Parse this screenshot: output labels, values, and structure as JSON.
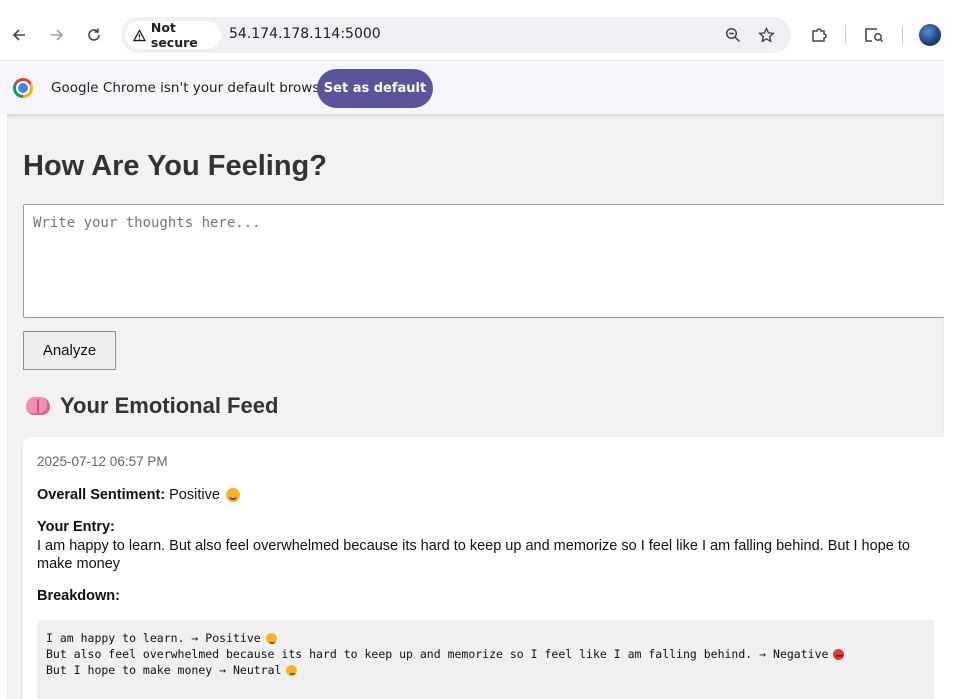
{
  "browser": {
    "security_chip": "Not secure",
    "url": "54.174.178.114:5000",
    "infobar_message": "Google Chrome isn't your default browser",
    "set_default_label": "Set as default",
    "accent_color": "#5a559b"
  },
  "page": {
    "title": "How Are You Feeling?",
    "textarea_placeholder": "Write your thoughts here...",
    "textarea_value": "",
    "analyze_label": "Analyze",
    "feed_heading": "Your Emotional Feed",
    "feed_icon": "brain-icon"
  },
  "feed": [
    {
      "timestamp": "2025-07-12 06:57 PM",
      "overall_label": "Overall Sentiment:",
      "overall_value": "Positive",
      "overall_icon": "smiling-face-icon",
      "entry_label": "Your Entry:",
      "entry_text": "I am happy to learn. But also feel overwhelmed because its hard to keep up and memorize so I feel like I am falling behind. But I hope to make money",
      "breakdown_label": "Breakdown:",
      "breakdown": [
        {
          "sentence": "I am happy to learn.",
          "arrow": "→",
          "sentiment": "Positive",
          "icon": "smiling-face-icon"
        },
        {
          "sentence": "But also feel overwhelmed because its hard to keep up and memorize so I feel like I am falling behind.",
          "arrow": "→",
          "sentiment": "Negative",
          "icon": "angry-face-icon"
        },
        {
          "sentence": "But I hope to make money",
          "arrow": "→",
          "sentiment": "Neutral",
          "icon": "neutral-face-icon"
        }
      ]
    }
  ]
}
